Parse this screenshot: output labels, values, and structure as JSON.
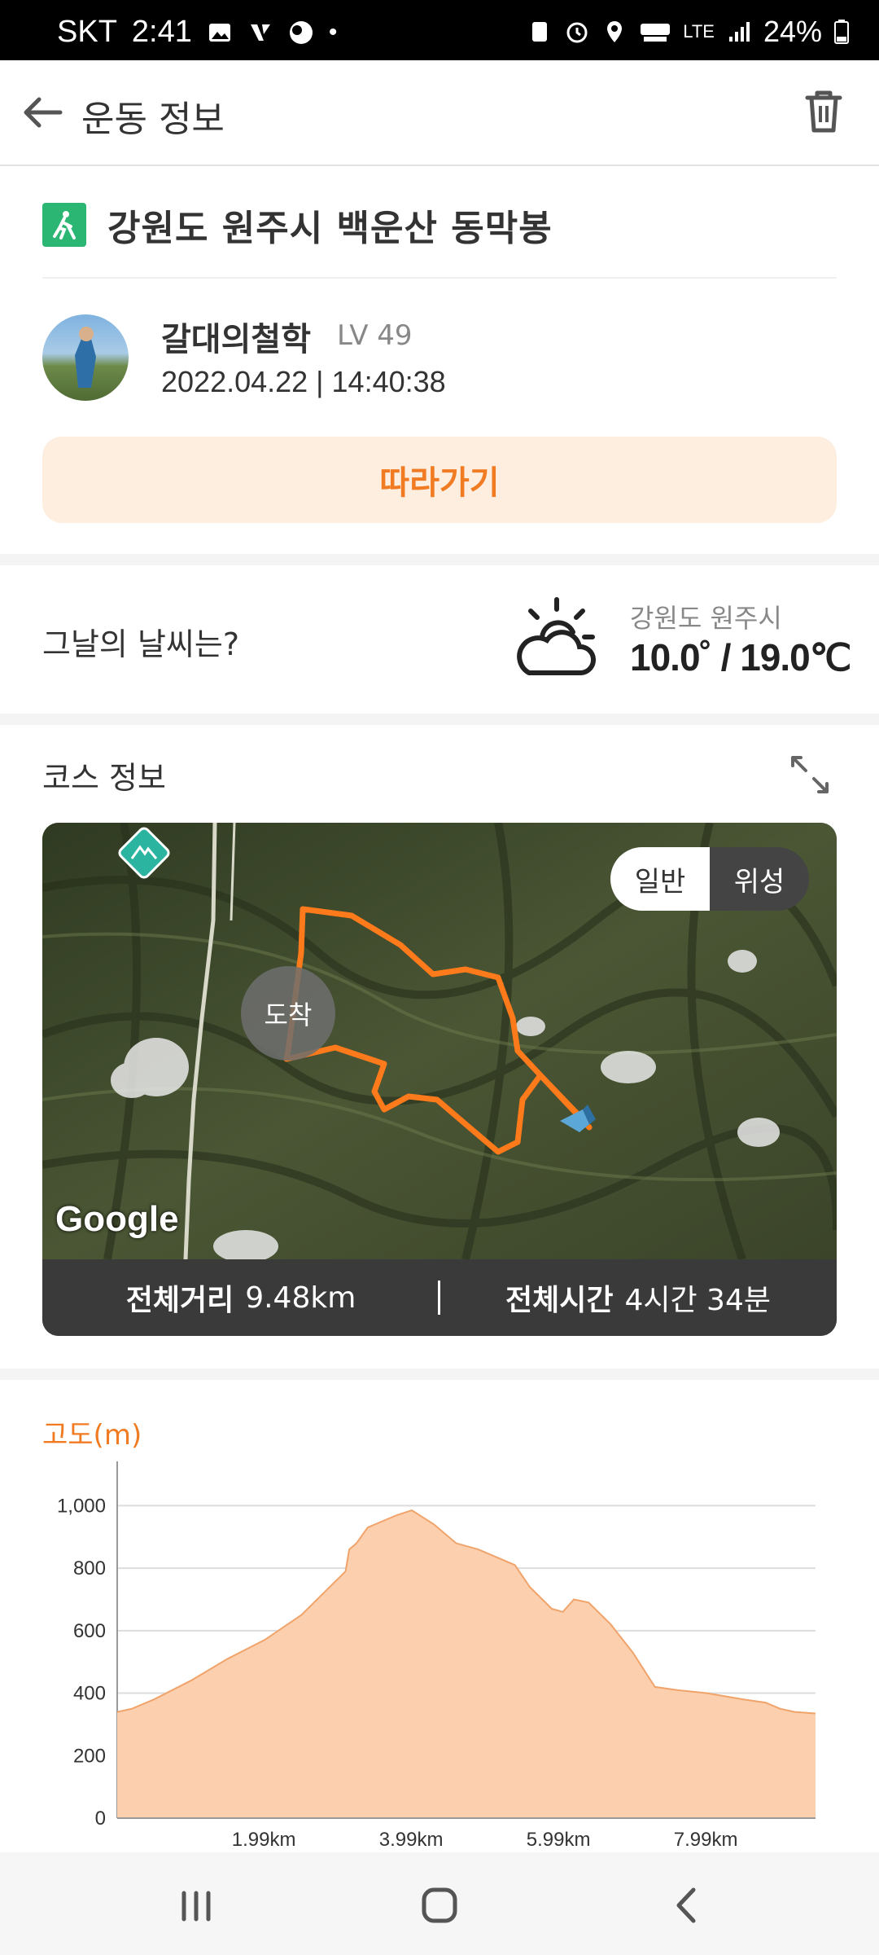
{
  "status_bar": {
    "carrier": "SKT",
    "time": "2:41",
    "network": "LTE",
    "battery": "24%"
  },
  "app_bar": {
    "title": "운동 정보"
  },
  "location": {
    "title": "강원도 원주시 백운산 동막봉"
  },
  "user": {
    "name": "갈대의철학",
    "level": "LV 49",
    "datetime": "2022.04.22 | 14:40:38"
  },
  "follow_button": "따라가기",
  "weather": {
    "question": "그날의 날씨는?",
    "location": "강원도 원주시",
    "temperature": "10.0˚ / 19.0℃"
  },
  "course": {
    "title": "코스 정보",
    "map_toggle": [
      "일반",
      "위성"
    ],
    "arrive_label": "도착",
    "map_brand": "Google",
    "distance_label": "전체거리",
    "distance_value": "9.48km",
    "time_label": "전체시간",
    "time_value": "4시간 34분"
  },
  "altitude": {
    "title": "고도(m)"
  },
  "chart_data": {
    "type": "area",
    "title": "고도(m)",
    "xlabel": "",
    "ylabel": "",
    "ylim": [
      0,
      1100
    ],
    "xlim": [
      0,
      9.48
    ],
    "y_ticks": [
      "0",
      "200",
      "400",
      "600",
      "800",
      "1,000"
    ],
    "x_ticks": [
      "1.99km",
      "3.99km",
      "5.99km",
      "7.99km"
    ],
    "x_tick_values": [
      1.99,
      3.99,
      5.99,
      7.99
    ],
    "x": [
      0,
      0.2,
      0.5,
      1.0,
      1.5,
      2.0,
      2.5,
      2.8,
      3.1,
      3.15,
      3.25,
      3.4,
      3.6,
      3.8,
      4.0,
      4.3,
      4.6,
      4.9,
      5.1,
      5.4,
      5.6,
      5.9,
      6.05,
      6.2,
      6.4,
      6.7,
      7.0,
      7.3,
      7.6,
      8.0,
      8.5,
      8.8,
      9.0,
      9.2,
      9.48
    ],
    "values": [
      340,
      350,
      380,
      440,
      510,
      570,
      650,
      720,
      790,
      860,
      880,
      930,
      950,
      970,
      985,
      940,
      880,
      860,
      840,
      810,
      740,
      670,
      660,
      700,
      690,
      620,
      530,
      420,
      410,
      400,
      380,
      370,
      350,
      340,
      335
    ],
    "grid": true,
    "fill_color": "#fcd0ae",
    "line_color": "#f0a36a"
  },
  "colors": {
    "accent": "#f07b22",
    "route": "#ff7a1a",
    "location_icon": "#2bb673"
  },
  "icons": {
    "back": "arrow-left-icon",
    "trash": "trash-icon",
    "location": "hiking-icon",
    "weather": "partly-cloudy-icon",
    "expand": "expand-icon"
  }
}
